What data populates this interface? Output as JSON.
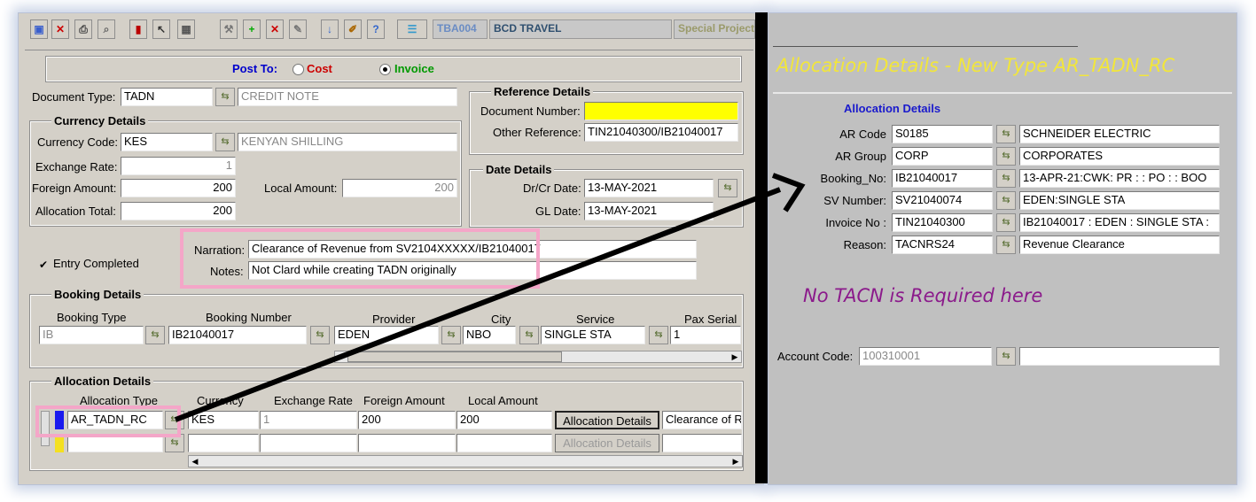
{
  "toolbar": {
    "code": "TBA004",
    "company": "BCD TRAVEL",
    "project": "Special Project",
    "icons": [
      "save-icon",
      "delete-icon",
      "print-icon",
      "preview-icon",
      "book-icon",
      "cursor-icon",
      "calculator-icon",
      "tools-icon",
      "add-icon",
      "remove-icon",
      "edit-icon",
      "download-icon",
      "note-icon",
      "help-icon",
      "grid-icon"
    ]
  },
  "post_to": {
    "label": "Post To:",
    "option_cost": "Cost",
    "option_invoice": "Invoice",
    "selected": "Invoice"
  },
  "document": {
    "type_label": "Document Type:",
    "type_value": "TADN",
    "type_desc": "CREDIT NOTE"
  },
  "currency": {
    "title": "Currency Details",
    "code_label": "Currency Code:",
    "code_value": "KES",
    "code_desc": "KENYAN SHILLING",
    "rate_label": "Exchange Rate:",
    "rate_value": "1",
    "foreign_label": "Foreign Amount:",
    "foreign_value": "200",
    "local_label": "Local Amount:",
    "local_value": "200",
    "alloc_label": "Allocation Total:",
    "alloc_value": "200"
  },
  "reference": {
    "title": "Reference Details",
    "doc_num_label": "Document Number:",
    "doc_num_value": "",
    "other_label": "Other Reference:",
    "other_value": "TIN21040300/IB21040017"
  },
  "dates": {
    "title": "Date Details",
    "drcr_label": "Dr/Cr Date:",
    "drcr_value": "13-MAY-2021",
    "gl_label": "GL Date:",
    "gl_value": "13-MAY-2021"
  },
  "entry": {
    "label": "Entry Completed",
    "checked": true
  },
  "narration": {
    "label": "Narration:",
    "value": "Clearance of Revenue from SV2104XXXXX/IB21040017"
  },
  "notes": {
    "label": "Notes:",
    "value": "Not Clard while creating TADN originally"
  },
  "booking": {
    "title": "Booking Details",
    "headers": [
      "Booking Type",
      "Booking Number",
      "Provider",
      "City",
      "Service",
      "Pax Serial"
    ],
    "row": [
      "IB",
      "IB21040017",
      "EDEN",
      "NBO",
      "SINGLE STA",
      "1"
    ]
  },
  "allocation": {
    "title": "Allocation Details",
    "headers": [
      "Allocation Type",
      "Currency",
      "Exchange Rate",
      "Foreign Amount",
      "Local Amount"
    ],
    "row1": {
      "type": "AR_TADN_RC",
      "currency": "KES",
      "rate": "1",
      "foreign": "200",
      "local": "200",
      "button": "Allocation Details",
      "desc": "Clearance of Re"
    },
    "row2": {
      "button": "Allocation Details"
    }
  },
  "right": {
    "header": "Allocation Details - New Type AR_TADN_RC",
    "section": "Allocation Details",
    "rows": [
      {
        "label": "AR Code",
        "code": "S0185",
        "desc": "SCHNEIDER ELECTRIC"
      },
      {
        "label": "AR Group",
        "code": "CORP",
        "desc": "CORPORATES"
      },
      {
        "label": "Booking_No:",
        "code": "IB21040017",
        "desc": "13-APR-21:CWK: PR : : PO : : BOO"
      },
      {
        "label": "SV Number:",
        "code": "SV21040074",
        "desc": "EDEN:SINGLE STA"
      },
      {
        "label": "Invoice No :",
        "code": "TIN21040300",
        "desc": "IB21040017 : EDEN : SINGLE STA :"
      },
      {
        "label": "Reason:",
        "code": "TACNRS24",
        "desc": "Revenue Clearance"
      }
    ],
    "note": "No TACN is Required here",
    "account_label": "Account Code:",
    "account_value": "100310001",
    "account_desc": ""
  },
  "colors": {
    "post_to": "#0000cc",
    "cost": "#cc0000",
    "invoice": "#009900",
    "header_yellow": "#f2e63a",
    "note_purple": "#8b1a8b",
    "section_blue": "#1a1acc",
    "doc_num_bg": "#ffff00"
  }
}
